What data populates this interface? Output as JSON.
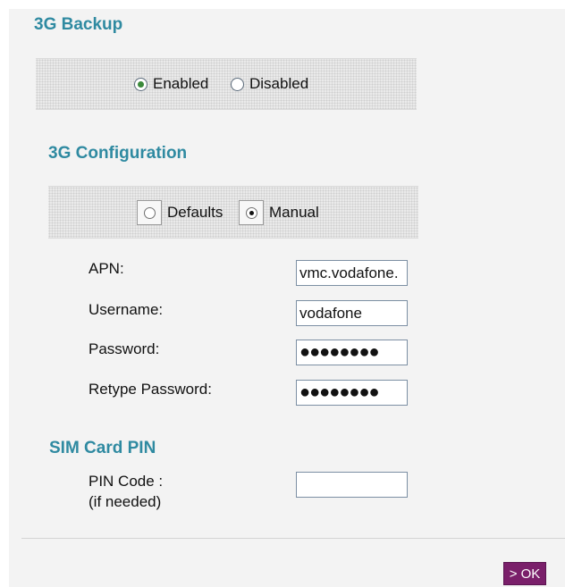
{
  "backup": {
    "title": "3G Backup",
    "options": [
      "Enabled",
      "Disabled"
    ],
    "selected": "Enabled"
  },
  "config": {
    "title": "3G Configuration",
    "options": [
      "Defaults",
      "Manual"
    ],
    "selected": "Manual",
    "fields": [
      {
        "label": "APN:",
        "value": "vmc.vodafone."
      },
      {
        "label": "Username:",
        "value": "vodafone"
      },
      {
        "label": "Password:",
        "value": "●●●●●●●●"
      },
      {
        "label": "Retype Password:",
        "value": "●●●●●●●●"
      }
    ]
  },
  "sim": {
    "title": "SIM Card PIN",
    "pin_label_line1": "PIN Code :",
    "pin_label_line2": "(if needed)",
    "pin_value": ""
  },
  "actions": {
    "ok_label": "> OK"
  },
  "colors": {
    "heading": "#2f8aa1",
    "button": "#7a1f6a"
  }
}
